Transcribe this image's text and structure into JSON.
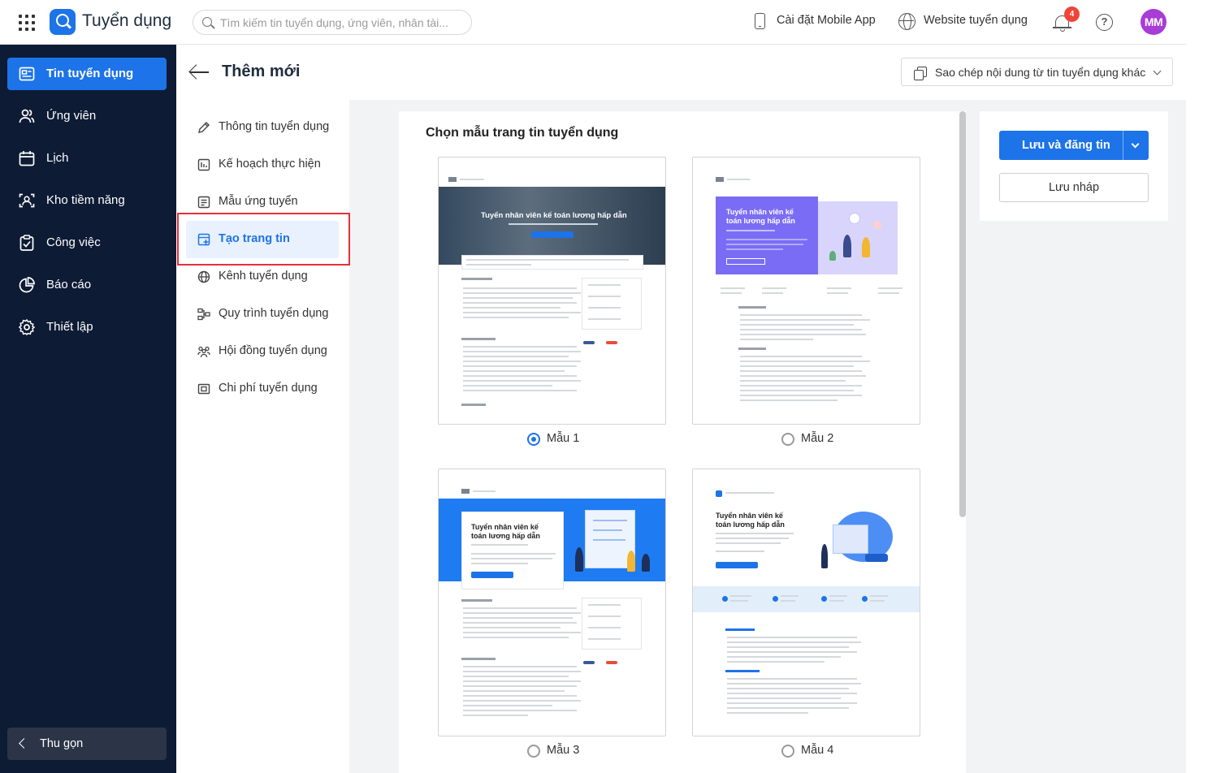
{
  "app": {
    "title": "Tuyển dụng"
  },
  "search": {
    "placeholder": "Tìm kiếm tin tuyển dụng, ứng viên, nhân tài..."
  },
  "topbar": {
    "mobile_app": "Cài đặt Mobile App",
    "website": "Website tuyển dụng",
    "notification_count": "4",
    "avatar_initials": "MM"
  },
  "sidebar": {
    "items": [
      {
        "label": "Tin tuyển dụng",
        "icon": "news-icon",
        "active": true
      },
      {
        "label": "Ứng viên",
        "icon": "users-icon"
      },
      {
        "label": "Lịch",
        "icon": "calendar-icon"
      },
      {
        "label": "Kho tiềm năng",
        "icon": "talent-pool-icon"
      },
      {
        "label": "Công việc",
        "icon": "task-icon"
      },
      {
        "label": "Báo cáo",
        "icon": "pie-chart-icon"
      },
      {
        "label": "Thiết lập",
        "icon": "gear-icon"
      }
    ],
    "collapse_label": "Thu gọn"
  },
  "page": {
    "title": "Thêm mới",
    "copy_button": "Sao chép nội dung từ tin tuyển dụng khác"
  },
  "submenu": {
    "items": [
      {
        "label": "Thông tin tuyển dụng",
        "icon": "pencil-icon"
      },
      {
        "label": "Kế hoạch thực hiện",
        "icon": "plan-icon"
      },
      {
        "label": "Mẫu ứng tuyển",
        "icon": "form-icon"
      },
      {
        "label": "Tạo trang tin",
        "icon": "page-add-icon",
        "active": true
      },
      {
        "label": "Kênh tuyển dụng",
        "icon": "globe-icon"
      },
      {
        "label": "Quy trình tuyển dụng",
        "icon": "flow-icon"
      },
      {
        "label": "Hội đồng tuyển dụng",
        "icon": "committee-icon"
      },
      {
        "label": "Chi phí tuyển dụng",
        "icon": "cost-icon"
      }
    ]
  },
  "templates": {
    "heading": "Chọn mẫu trang tin tuyển dụng",
    "selected": "Mẫu 1",
    "items": [
      {
        "label": "Mẫu 1",
        "headline": "Tuyển nhân viên kế toán lương hấp dẫn"
      },
      {
        "label": "Mẫu 2",
        "headline": "Tuyển nhân viên kế toán lương hấp dẫn"
      },
      {
        "label": "Mẫu 3",
        "headline": "Tuyển nhân viên kế toán lương hấp dẫn"
      },
      {
        "label": "Mẫu 4",
        "headline": "Tuyển nhân viên kế toán lương hấp dẫn"
      }
    ]
  },
  "actions": {
    "save_publish": "Lưu và đăng tin",
    "save_draft": "Lưu nháp"
  },
  "colors": {
    "primary": "#1d73e8",
    "sidebar_bg": "#0d1b34",
    "badge": "#f04438",
    "avatar": "#a93bd6",
    "highlight": "#e3313b"
  }
}
